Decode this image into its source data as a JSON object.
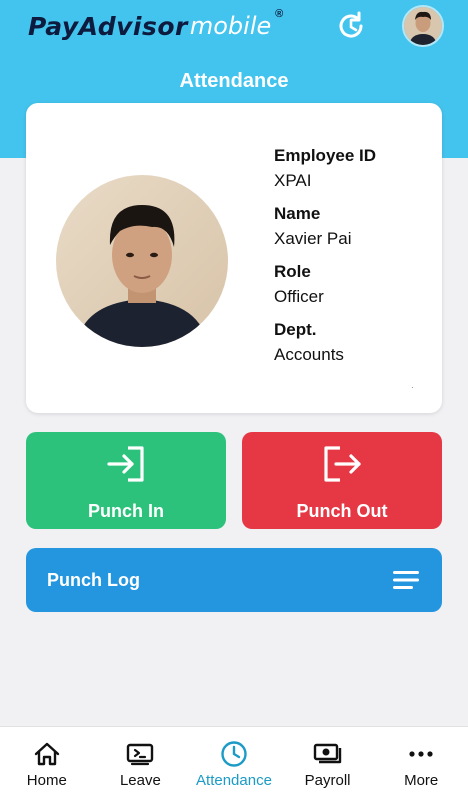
{
  "header": {
    "logo_text": "PayAdvisor",
    "logo_suffix": "mobile",
    "logo_reg": "®",
    "title": "Attendance",
    "refresh_icon": "refresh-icon",
    "avatar": "user-avatar"
  },
  "profile": {
    "employee_id_label": "Employee ID",
    "employee_id": "XPAI",
    "name_label": "Name",
    "name": "Xavier Pai",
    "role_label": "Role",
    "role": "Officer",
    "dept_label": "Dept.",
    "dept": "Accounts"
  },
  "actions": {
    "punch_in_label": "Punch In",
    "punch_out_label": "Punch Out",
    "punch_log_label": "Punch Log"
  },
  "colors": {
    "header": "#43c4ee",
    "punch_in": "#2cc27c",
    "punch_out": "#e63744",
    "punch_log": "#2496e0",
    "active_tab": "#1b9bc6"
  },
  "nav": {
    "items": [
      {
        "label": "Home",
        "icon": "home-icon"
      },
      {
        "label": "Leave",
        "icon": "leave-icon"
      },
      {
        "label": "Attendance",
        "icon": "clock-icon",
        "active": true
      },
      {
        "label": "Payroll",
        "icon": "money-icon"
      },
      {
        "label": "More",
        "icon": "more-icon"
      }
    ]
  }
}
